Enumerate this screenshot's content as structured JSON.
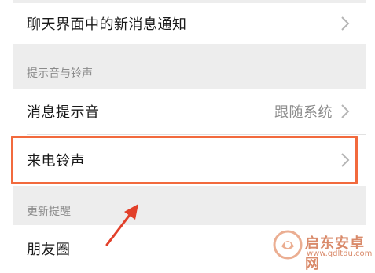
{
  "rows": {
    "chat_notify": "聊天界面中的新消息通知",
    "message_tone": "消息提示音",
    "message_tone_value": "跟随系统",
    "ringtone": "来电铃声",
    "moments": "朋友圈"
  },
  "sections": {
    "tones": "提示音与铃声",
    "updates": "更新提醒"
  },
  "watermark": {
    "name": "启东安卓网",
    "url": "www.qdltdu.com"
  },
  "colors": {
    "highlight": "#f26a3d",
    "arrow": "#e2402a",
    "section_bg": "#ededed"
  }
}
